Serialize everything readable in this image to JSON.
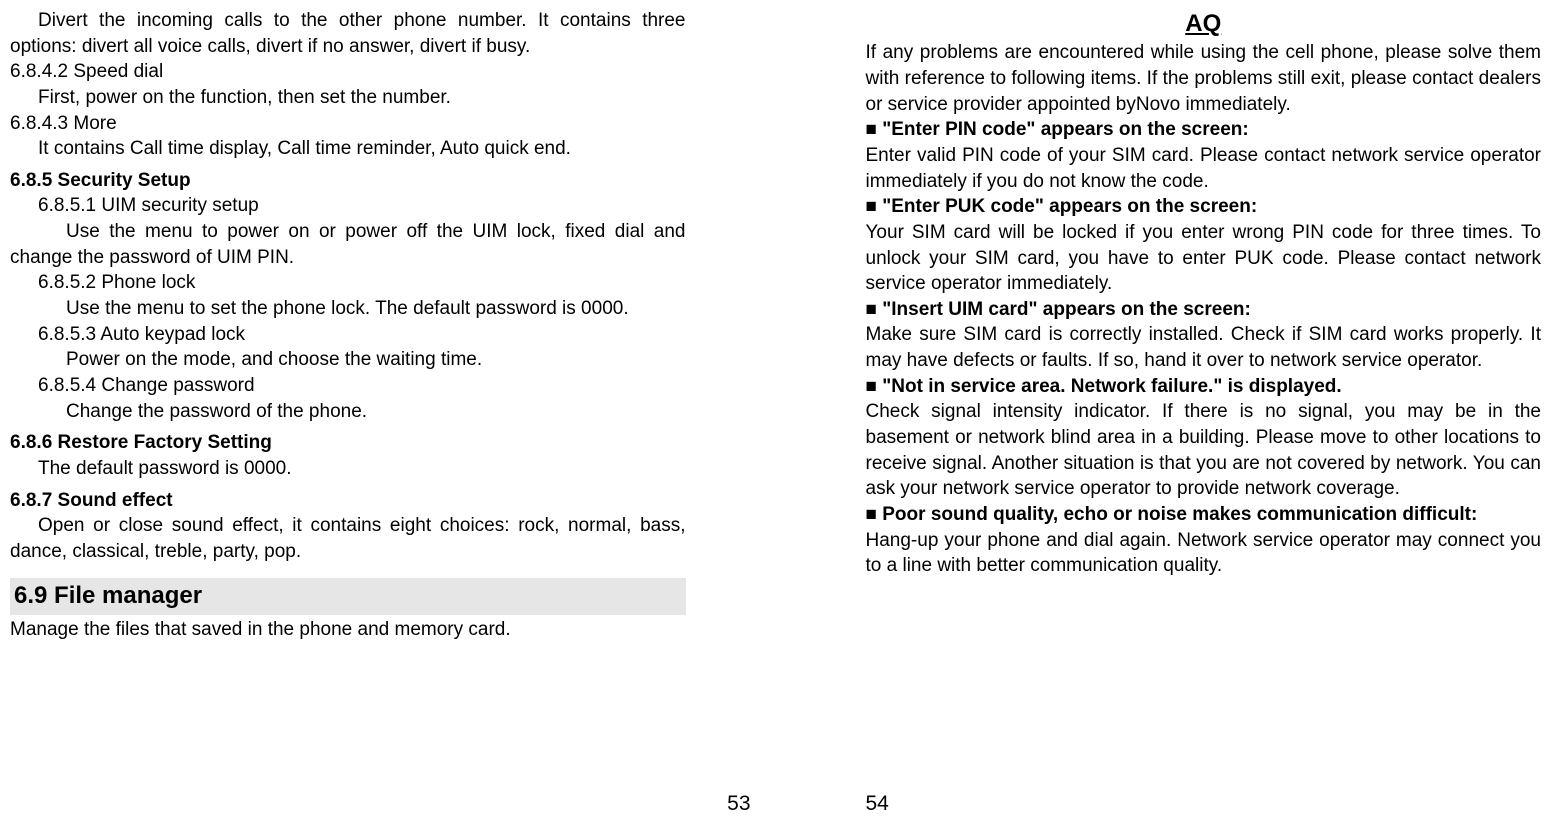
{
  "left": {
    "p1": "Divert the incoming calls to the other phone number. It contains three options: divert all voice calls, divert if no answer, divert if busy.",
    "s6842_t": "6.8.4.2 Speed dial",
    "s6842_b": "First, power on the function, then set the number.",
    "s6843_t": "6.8.4.3 More",
    "s6843_b": "It contains Call time display, Call time reminder, Auto quick end.",
    "s685_t": "6.8.5 Security Setup",
    "s6851_t": "6.8.5.1 UIM security setup",
    "s6851_b": "Use the menu to power on or power off the UIM lock, fixed dial and change the password of UIM PIN.",
    "s6852_t": "6.8.5.2 Phone lock",
    "s6852_b": "Use the menu to set the phone lock. The default password is 0000.",
    "s6853_t": "6.8.5.3 Auto keypad lock",
    "s6853_b": "Power on the mode, and choose the waiting time.",
    "s6854_t": "6.8.5.4 Change password",
    "s6854_b": "Change the password of the phone.",
    "s686_t": "6.8.6 Restore Factory Setting",
    "s686_b": "The default password is 0000.",
    "s687_t": "6.8.7 Sound effect",
    "s687_b": "Open or close sound effect, it contains eight choices: rock, normal, bass, dance, classical, treble, party, pop.",
    "s69_t": "6.9 File manager",
    "s69_b": "Manage the files that saved in the phone and memory card.",
    "pagenum": "53"
  },
  "right": {
    "title": "AQ",
    "intro": "If any problems are encountered while using the cell phone, please solve them with reference to following items. If the problems still exit, please contact dealers or service provider appointed byNovo immediately.",
    "q1t": "■ \"Enter PIN code\" appears on the screen:",
    "q1b": "Enter valid PIN code of your SIM card. Please contact network service operator immediately if you do not know the code.",
    "q2t": "■ \"Enter PUK code\" appears on the screen:",
    "q2b": "Your SIM card will be locked if you enter wrong PIN code for three times. To unlock your SIM card, you have to enter PUK code. Please contact network service operator immediately.",
    "q3t": "■ \"Insert UIM card\" appears on the screen:",
    "q3b": "Make sure SIM card is correctly installed. Check if SIM card works properly. It may have defects or faults. If so, hand it over to network service operator.",
    "q4t": "■ \"Not in service area. Network failure.\" is displayed.",
    "q4b": "Check signal intensity indicator. If there is no signal, you may be in the basement or network blind area in a building. Please move to other locations to receive signal. Another situation is that you are not covered by network. You can ask your network service operator to provide network coverage.",
    "q5t": "■ Poor sound quality, echo or noise makes communication difficult:",
    "q5b": "Hang-up your phone and dial again. Network service operator may connect you to a line with better communication quality.",
    "pagenum": "54"
  }
}
